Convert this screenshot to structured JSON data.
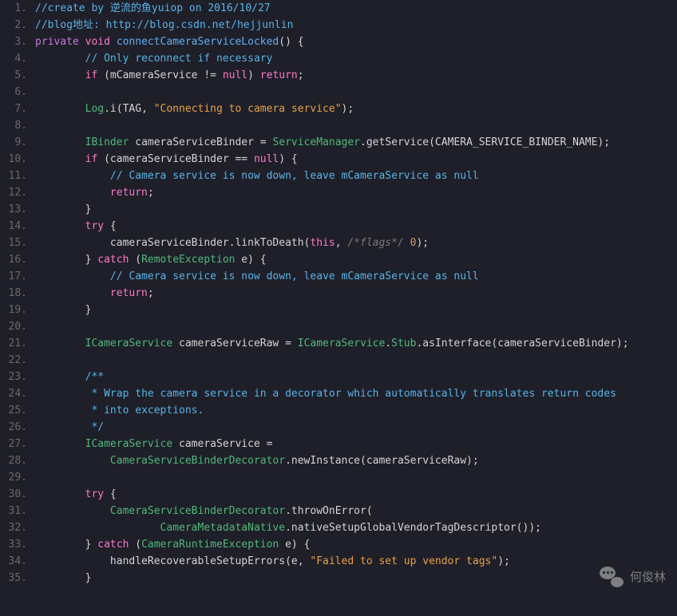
{
  "lines": [
    {
      "n": "1.",
      "tokens": [
        {
          "t": "//create by 逆流的鱼yuiop on 2016/10/27",
          "c": "c-comment"
        }
      ]
    },
    {
      "n": "2.",
      "tokens": [
        {
          "t": "//blog地址: http://blog.csdn.net/hejjunlin",
          "c": "c-comment"
        }
      ]
    },
    {
      "n": "3.",
      "tokens": [
        {
          "t": "private",
          "c": "c-modifier"
        },
        {
          "t": " "
        },
        {
          "t": "void",
          "c": "c-keyword"
        },
        {
          "t": " "
        },
        {
          "t": "connectCameraServiceLocked",
          "c": "c-method"
        },
        {
          "t": "() {",
          "c": "c-punct"
        }
      ]
    },
    {
      "n": "4.",
      "tokens": [
        {
          "t": "        "
        },
        {
          "t": "// Only reconnect if necessary",
          "c": "c-comment"
        }
      ]
    },
    {
      "n": "5.",
      "tokens": [
        {
          "t": "        "
        },
        {
          "t": "if",
          "c": "c-keyword"
        },
        {
          "t": " (mCameraService != ",
          "c": "c-punct"
        },
        {
          "t": "null",
          "c": "c-keyword"
        },
        {
          "t": ") ",
          "c": "c-punct"
        },
        {
          "t": "return",
          "c": "c-keyword"
        },
        {
          "t": ";",
          "c": "c-punct"
        }
      ]
    },
    {
      "n": "6.",
      "tokens": [
        {
          "t": " "
        }
      ]
    },
    {
      "n": "7.",
      "tokens": [
        {
          "t": "        "
        },
        {
          "t": "Log",
          "c": "c-type"
        },
        {
          "t": ".i(TAG, ",
          "c": "c-punct"
        },
        {
          "t": "\"Connecting to camera service\"",
          "c": "c-string"
        },
        {
          "t": ");",
          "c": "c-punct"
        }
      ]
    },
    {
      "n": "8.",
      "tokens": [
        {
          "t": " "
        }
      ]
    },
    {
      "n": "9.",
      "tokens": [
        {
          "t": "        "
        },
        {
          "t": "IBinder",
          "c": "c-type"
        },
        {
          "t": " cameraServiceBinder = ",
          "c": "c-punct"
        },
        {
          "t": "ServiceManager",
          "c": "c-type"
        },
        {
          "t": ".getService(CAMERA_SERVICE_BINDER_NAME);",
          "c": "c-punct"
        }
      ]
    },
    {
      "n": "10.",
      "tokens": [
        {
          "t": "        "
        },
        {
          "t": "if",
          "c": "c-keyword"
        },
        {
          "t": " (cameraServiceBinder == ",
          "c": "c-punct"
        },
        {
          "t": "null",
          "c": "c-keyword"
        },
        {
          "t": ") {",
          "c": "c-punct"
        }
      ]
    },
    {
      "n": "11.",
      "tokens": [
        {
          "t": "            "
        },
        {
          "t": "// Camera service is now down, leave mCameraService as null",
          "c": "c-comment"
        }
      ]
    },
    {
      "n": "12.",
      "tokens": [
        {
          "t": "            "
        },
        {
          "t": "return",
          "c": "c-keyword"
        },
        {
          "t": ";",
          "c": "c-punct"
        }
      ]
    },
    {
      "n": "13.",
      "tokens": [
        {
          "t": "        }",
          "c": "c-punct"
        }
      ]
    },
    {
      "n": "14.",
      "tokens": [
        {
          "t": "        "
        },
        {
          "t": "try",
          "c": "c-keyword"
        },
        {
          "t": " {",
          "c": "c-punct"
        }
      ]
    },
    {
      "n": "15.",
      "tokens": [
        {
          "t": "            cameraServiceBinder.linkToDeath(",
          "c": "c-punct"
        },
        {
          "t": "this",
          "c": "c-this"
        },
        {
          "t": ", ",
          "c": "c-punct"
        },
        {
          "t": "/*flags*/",
          "c": "c-flag"
        },
        {
          "t": " "
        },
        {
          "t": "0",
          "c": "c-num"
        },
        {
          "t": ");",
          "c": "c-punct"
        }
      ]
    },
    {
      "n": "16.",
      "tokens": [
        {
          "t": "        } ",
          "c": "c-punct"
        },
        {
          "t": "catch",
          "c": "c-keyword"
        },
        {
          "t": " (",
          "c": "c-punct"
        },
        {
          "t": "RemoteException",
          "c": "c-type"
        },
        {
          "t": " e) {",
          "c": "c-punct"
        }
      ]
    },
    {
      "n": "17.",
      "tokens": [
        {
          "t": "            "
        },
        {
          "t": "// Camera service is now down, leave mCameraService as null",
          "c": "c-comment"
        }
      ]
    },
    {
      "n": "18.",
      "tokens": [
        {
          "t": "            "
        },
        {
          "t": "return",
          "c": "c-keyword"
        },
        {
          "t": ";",
          "c": "c-punct"
        }
      ]
    },
    {
      "n": "19.",
      "tokens": [
        {
          "t": "        }",
          "c": "c-punct"
        }
      ]
    },
    {
      "n": "20.",
      "tokens": [
        {
          "t": " "
        }
      ]
    },
    {
      "n": "21.",
      "tokens": [
        {
          "t": "        "
        },
        {
          "t": "ICameraService",
          "c": "c-type"
        },
        {
          "t": " cameraServiceRaw = ",
          "c": "c-punct"
        },
        {
          "t": "ICameraService",
          "c": "c-type"
        },
        {
          "t": ".",
          "c": "c-punct"
        },
        {
          "t": "Stub",
          "c": "c-type"
        },
        {
          "t": ".asInterface(cameraServiceBinder);",
          "c": "c-punct"
        }
      ]
    },
    {
      "n": "22.",
      "tokens": [
        {
          "t": " "
        }
      ]
    },
    {
      "n": "23.",
      "tokens": [
        {
          "t": "        "
        },
        {
          "t": "/**",
          "c": "c-comment"
        }
      ]
    },
    {
      "n": "24.",
      "tokens": [
        {
          "t": "         "
        },
        {
          "t": "* Wrap the camera service in a decorator which automatically translates return codes",
          "c": "c-comment"
        }
      ]
    },
    {
      "n": "25.",
      "tokens": [
        {
          "t": "         "
        },
        {
          "t": "* into exceptions.",
          "c": "c-comment"
        }
      ]
    },
    {
      "n": "26.",
      "tokens": [
        {
          "t": "         "
        },
        {
          "t": "*/",
          "c": "c-comment"
        }
      ]
    },
    {
      "n": "27.",
      "tokens": [
        {
          "t": "        "
        },
        {
          "t": "ICameraService",
          "c": "c-type"
        },
        {
          "t": " cameraService =",
          "c": "c-punct"
        }
      ]
    },
    {
      "n": "28.",
      "tokens": [
        {
          "t": "            "
        },
        {
          "t": "CameraServiceBinderDecorator",
          "c": "c-type"
        },
        {
          "t": ".newInstance(cameraServiceRaw);",
          "c": "c-punct"
        }
      ]
    },
    {
      "n": "29.",
      "tokens": [
        {
          "t": " "
        }
      ]
    },
    {
      "n": "30.",
      "tokens": [
        {
          "t": "        "
        },
        {
          "t": "try",
          "c": "c-keyword"
        },
        {
          "t": " {",
          "c": "c-punct"
        }
      ]
    },
    {
      "n": "31.",
      "tokens": [
        {
          "t": "            "
        },
        {
          "t": "CameraServiceBinderDecorator",
          "c": "c-type"
        },
        {
          "t": ".throwOnError(",
          "c": "c-punct"
        }
      ]
    },
    {
      "n": "32.",
      "tokens": [
        {
          "t": "                    "
        },
        {
          "t": "CameraMetadataNative",
          "c": "c-type"
        },
        {
          "t": ".nativeSetupGlobalVendorTagDescriptor());",
          "c": "c-punct"
        }
      ]
    },
    {
      "n": "33.",
      "tokens": [
        {
          "t": "        } ",
          "c": "c-punct"
        },
        {
          "t": "catch",
          "c": "c-keyword"
        },
        {
          "t": " (",
          "c": "c-punct"
        },
        {
          "t": "CameraRuntimeException",
          "c": "c-type"
        },
        {
          "t": " e) {",
          "c": "c-punct"
        }
      ]
    },
    {
      "n": "34.",
      "tokens": [
        {
          "t": "            handleRecoverableSetupErrors(e, ",
          "c": "c-punct"
        },
        {
          "t": "\"Failed to set up vendor tags\"",
          "c": "c-string"
        },
        {
          "t": ");",
          "c": "c-punct"
        }
      ]
    },
    {
      "n": "35.",
      "tokens": [
        {
          "t": "        }",
          "c": "c-punct"
        }
      ]
    }
  ],
  "watermark": "何俊林"
}
